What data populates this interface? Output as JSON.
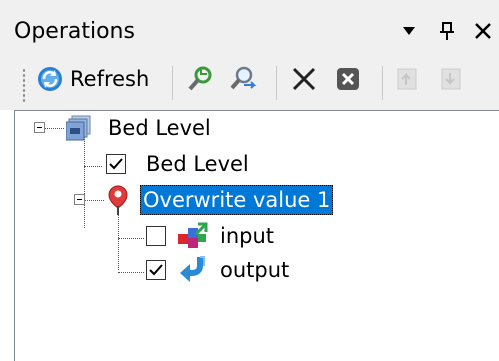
{
  "window": {
    "title": "Operations",
    "dropdown_glyph": "▼",
    "pin_glyph": "📌",
    "close_glyph": "✕"
  },
  "toolbar": {
    "refresh_label": "Refresh",
    "icons": [
      "refresh-icon",
      "add-operation-icon",
      "find-icon",
      "delete-icon",
      "remove-all-icon",
      "move-up-icon",
      "move-down-icon"
    ]
  },
  "tree": {
    "root": {
      "label": "Bed Level",
      "icon": "bed-level-icon",
      "expanded": true
    },
    "children": [
      {
        "label": "Bed Level",
        "checked": true
      },
      {
        "label": "Overwrite value 1",
        "icon": "pin-icon",
        "selected": true,
        "expanded": true,
        "children": [
          {
            "label": "input",
            "checked": false,
            "icon": "input-icon"
          },
          {
            "label": "output",
            "checked": true,
            "icon": "output-icon"
          }
        ]
      }
    ]
  },
  "colors": {
    "selection": "#0078d7",
    "chrome": "#f0f0f0"
  }
}
